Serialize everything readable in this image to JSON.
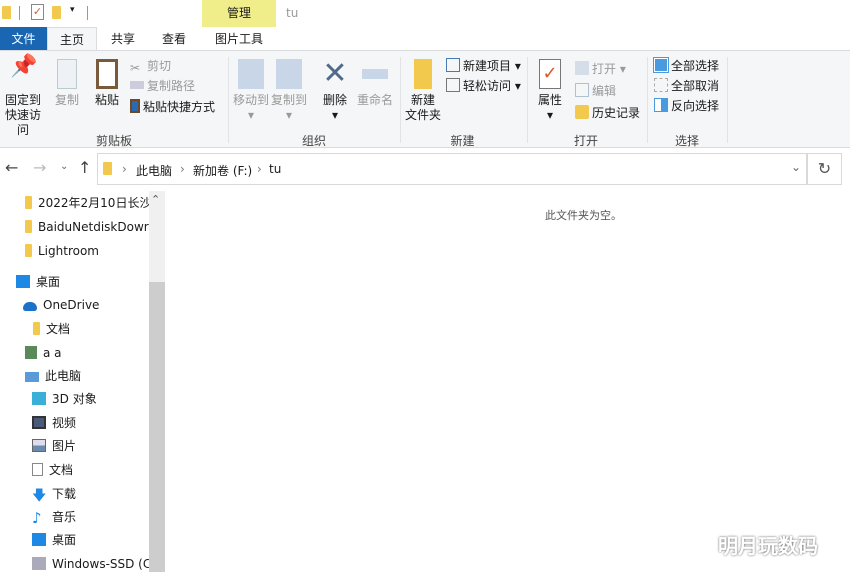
{
  "title_bar": {
    "context_tab": "管理",
    "folder_title": "tu"
  },
  "tabs": {
    "file": "文件",
    "home": "主页",
    "share": "共享",
    "view": "查看",
    "picture_tools": "图片工具"
  },
  "ribbon": {
    "clipboard": {
      "label": "剪贴板",
      "pin": "固定到\n快速访问",
      "pin1": "固定到",
      "pin2": "快速访问",
      "copy": "复制",
      "paste": "粘贴",
      "cut": "剪切",
      "copy_path": "复制路径",
      "paste_shortcut": "粘贴快捷方式"
    },
    "organize": {
      "label": "组织",
      "move_to": "移动到",
      "copy_to": "复制到",
      "delete": "删除",
      "rename": "重命名"
    },
    "new": {
      "label": "新建",
      "new_folder1": "新建",
      "new_folder2": "文件夹",
      "new_item": "新建项目",
      "easy_access": "轻松访问"
    },
    "open": {
      "label": "打开",
      "properties": "属性",
      "open": "打开",
      "edit": "编辑",
      "history": "历史记录"
    },
    "select": {
      "label": "选择",
      "select_all": "全部选择",
      "select_none": "全部取消",
      "invert": "反向选择"
    }
  },
  "address": {
    "crumbs": [
      "此电脑",
      "新加卷 (F:)",
      "tu"
    ]
  },
  "nav_pane": {
    "items": [
      "2022年2月10日长沙",
      "BaiduNetdiskDowr",
      "Lightroom",
      "桌面",
      "OneDrive",
      "文档",
      "a a",
      "此电脑",
      "3D 对象",
      "视频",
      "图片",
      "文档",
      "下载",
      "音乐",
      "桌面",
      "Windows-SSD (C:"
    ]
  },
  "content": {
    "empty_message": "此文件夹为空。"
  },
  "watermark": "明月玩数码"
}
